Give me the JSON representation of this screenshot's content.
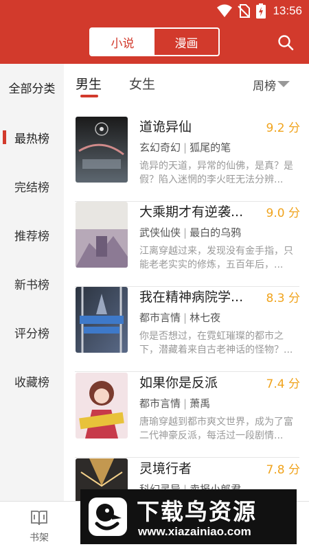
{
  "status_bar": {
    "time": "13:56"
  },
  "header": {
    "tabs": [
      {
        "label": "小说",
        "active": true
      },
      {
        "label": "漫画",
        "active": false
      }
    ],
    "accent_color": "#d23a2c"
  },
  "sidebar": {
    "all_categories": "全部分类",
    "items": [
      {
        "label": "最热榜",
        "active": true
      },
      {
        "label": "完结榜"
      },
      {
        "label": "推荐榜"
      },
      {
        "label": "新书榜"
      },
      {
        "label": "评分榜"
      },
      {
        "label": "收藏榜"
      }
    ]
  },
  "gender_tabs": [
    {
      "label": "男生",
      "active": true
    },
    {
      "label": "女生"
    }
  ],
  "period_select": {
    "label": "周榜"
  },
  "books": [
    {
      "title": "道诡异仙",
      "score": "9.2 分",
      "genre": "玄幻奇幻",
      "author": "狐尾的笔",
      "desc": "诡异的天道，异常的仙佛，是真？是假？陷入迷惘的李火旺无法分辨..."
    },
    {
      "title": "大乘期才有逆袭...",
      "score": "9.0 分",
      "genre": "武侠仙侠",
      "author": "最白的乌鸦",
      "desc": "江离穿越过来，发现没有金手指，只能老老实实的修炼，五百年后，..."
    },
    {
      "title": "我在精神病院学...",
      "score": "8.3 分",
      "genre": "都市言情",
      "author": "林七夜",
      "desc": "你是否想过，在霓虹璀璨的都市之下，潜藏着来自古老神话的怪物？..."
    },
    {
      "title": "如果你是反派",
      "score": "7.4 分",
      "genre": "都市言情",
      "author": "萧禹",
      "desc": "唐瑜穿越到都市爽文世界，成为了富二代神豪反派，每活过一段剧情..."
    },
    {
      "title": "灵境行者",
      "score": "7.8 分",
      "genre": "科幻灵异",
      "author": "卖报小郎君",
      "desc": ""
    }
  ],
  "bottom_nav": {
    "shelf": "书架"
  },
  "watermark": {
    "title": "下载鸟资源",
    "url": "www.xiazainiao.com"
  }
}
